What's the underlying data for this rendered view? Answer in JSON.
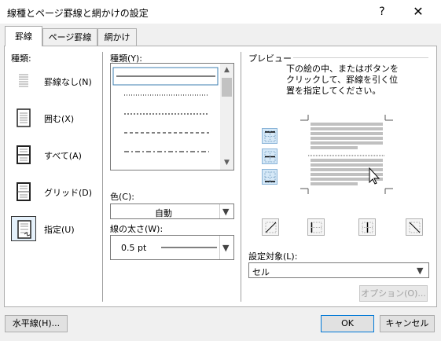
{
  "window": {
    "title": "線種とページ罫線と網かけの設定",
    "help_label": "?",
    "close_label": "✕"
  },
  "tabs": [
    {
      "label": "罫線",
      "active": true
    },
    {
      "label": "ページ罫線",
      "active": false
    },
    {
      "label": "網かけ",
      "active": false
    }
  ],
  "setting": {
    "heading": "種類:",
    "options": [
      {
        "label": "罫線なし(N)",
        "icon": "no-border-icon",
        "selected": false
      },
      {
        "label": "囲む(X)",
        "icon": "box-border-icon",
        "selected": false
      },
      {
        "label": "すべて(A)",
        "icon": "all-borders-icon",
        "selected": false
      },
      {
        "label": "グリッド(D)",
        "icon": "grid-border-icon",
        "selected": false
      },
      {
        "label": "指定(U)",
        "icon": "custom-border-icon",
        "selected": true
      }
    ]
  },
  "style": {
    "heading": "種類(Y):",
    "line_styles": [
      "solid",
      "dotted",
      "dashed-small",
      "dashed",
      "dash-dot"
    ],
    "selected_index": 0
  },
  "color": {
    "label": "色(C):",
    "value": "自動"
  },
  "width": {
    "label": "線の太さ(W):",
    "value": "0.5 pt"
  },
  "preview": {
    "heading": "プレビュー",
    "instruction": [
      "下の絵の中、またはボタンを",
      "クリックして、罫線を引く位",
      "置を指定してください。"
    ],
    "edge_buttons": [
      "top-border-icon",
      "inside-horizontal-border-icon",
      "bottom-border-icon"
    ],
    "bottom_buttons": [
      "diagonal-up-border-icon",
      "left-border-icon",
      "inside-vertical-border-icon",
      "right-border-icon",
      "diagonal-down-border-icon"
    ]
  },
  "apply_to": {
    "label": "設定対象(L):",
    "value": "セル"
  },
  "buttons": {
    "options": "オプション(O)...",
    "horizontal_line": "水平線(H)...",
    "ok": "OK",
    "cancel": "キャンセル"
  },
  "colors": {
    "accent": "#0078d7",
    "selected_bg": "#e5f1fb",
    "preview_bar": "#c0c0c0"
  }
}
